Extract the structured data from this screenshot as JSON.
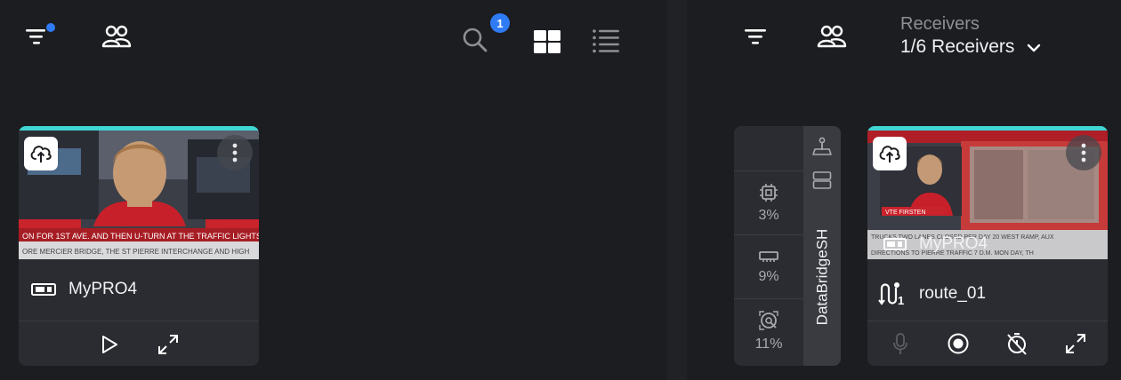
{
  "left": {
    "toolbar": {
      "filter_icon": "filter-icon",
      "users_icon": "users-icon",
      "search_icon": "search-icon",
      "search_badge": "1",
      "grid_icon": "grid-view-icon",
      "list_icon": "list-view-icon"
    },
    "card": {
      "device_name": "MyPRO4",
      "actions": [
        "play-icon",
        "expand-icon"
      ]
    }
  },
  "right": {
    "receivers_label": "Receivers",
    "receivers_value": "1/6 Receivers",
    "stats": {
      "server_name": "DataBridgeSH",
      "cpu": "3%",
      "memory": "9%",
      "disk": "11%"
    },
    "card": {
      "device_name": "MyPRO4",
      "route_name": "route_01",
      "route_count": "1",
      "actions": [
        "mic-icon",
        "record-icon",
        "timer-off-icon",
        "expand-icon"
      ]
    }
  },
  "colors": {
    "accent": "#2f7bf5",
    "card_topline": "#3fd6d3"
  }
}
